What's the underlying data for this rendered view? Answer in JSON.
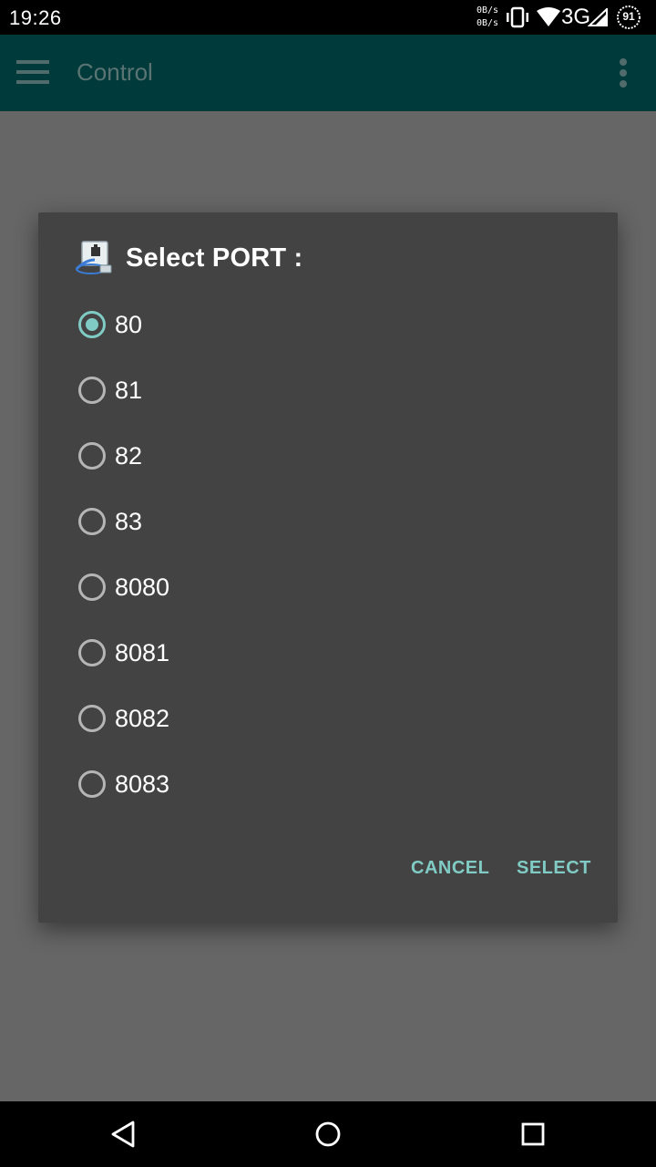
{
  "status_bar": {
    "time": "19:26",
    "speed_up": "0B/s",
    "speed_down": "0B/s",
    "network": "3G",
    "battery": "91",
    "icons": [
      "vibrate-icon",
      "wifi-icon",
      "signal-icon",
      "battery-icon"
    ]
  },
  "app_bar": {
    "title": "Control",
    "icons": [
      "menu-icon",
      "overflow-menu-icon"
    ],
    "color": "#003a3a"
  },
  "dialog": {
    "title": "Select PORT :",
    "icon": "network-port-icon",
    "options": [
      {
        "label": "80",
        "selected": true
      },
      {
        "label": "81",
        "selected": false
      },
      {
        "label": "82",
        "selected": false
      },
      {
        "label": "83",
        "selected": false
      },
      {
        "label": "8080",
        "selected": false
      },
      {
        "label": "8081",
        "selected": false
      },
      {
        "label": "8082",
        "selected": false
      },
      {
        "label": "8083",
        "selected": false
      }
    ],
    "cancel_label": "CANCEL",
    "select_label": "SELECT",
    "accent_color": "#80cbc4"
  },
  "nav_bar": {
    "icons": [
      "back-icon",
      "home-icon",
      "recents-icon"
    ]
  }
}
